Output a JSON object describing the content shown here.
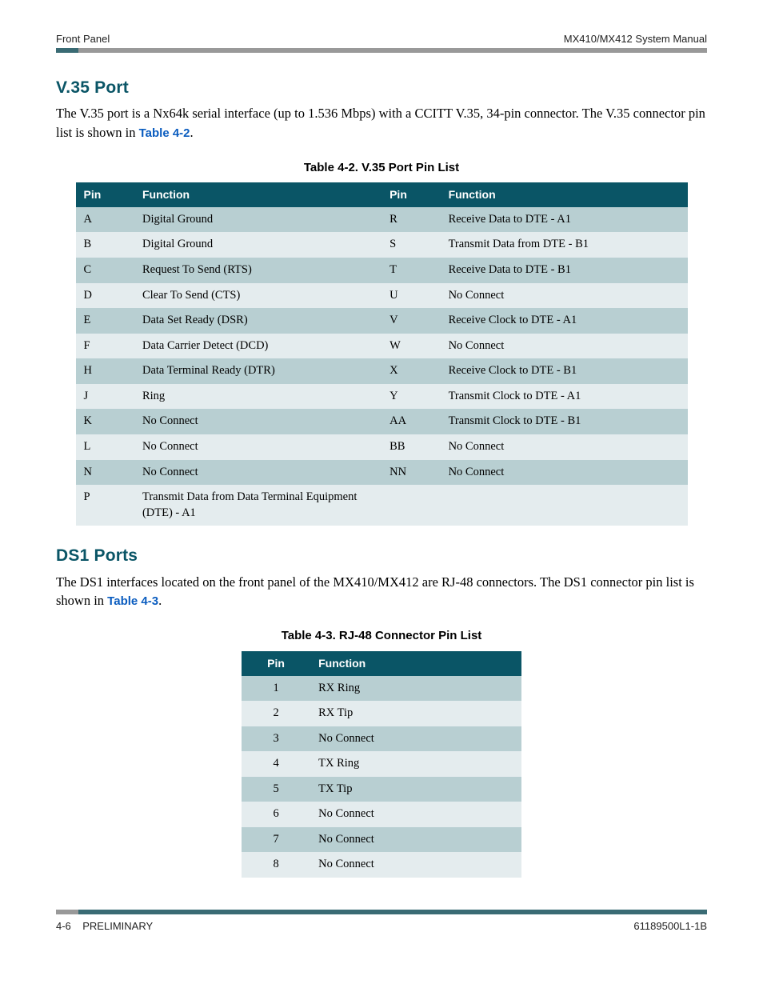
{
  "header": {
    "left": "Front Panel",
    "right": "MX410/MX412 System Manual"
  },
  "section1": {
    "heading": "V.35 Port",
    "para_a": "The V.35 port is a Nx64k serial interface (up to 1.536 Mbps) with a CCITT V.35, 34-pin connector. The V.35 connector pin list is shown in ",
    "xref": "Table 4-2",
    "para_b": "."
  },
  "table1": {
    "caption": "Table 4-2.  V.35 Port Pin List",
    "head": {
      "pin": "Pin",
      "func": "Function"
    },
    "rows": [
      {
        "p1": "A",
        "f1": "Digital Ground",
        "p2": "R",
        "f2": "Receive Data to DTE - A1"
      },
      {
        "p1": "B",
        "f1": "Digital Ground",
        "p2": "S",
        "f2": "Transmit Data from DTE - B1"
      },
      {
        "p1": "C",
        "f1": "Request To Send (RTS)",
        "p2": "T",
        "f2": "Receive Data to DTE - B1"
      },
      {
        "p1": "D",
        "f1": "Clear To Send (CTS)",
        "p2": "U",
        "f2": "No Connect"
      },
      {
        "p1": "E",
        "f1": "Data Set Ready (DSR)",
        "p2": "V",
        "f2": "Receive Clock to DTE - A1"
      },
      {
        "p1": "F",
        "f1": "Data Carrier Detect (DCD)",
        "p2": "W",
        "f2": "No Connect"
      },
      {
        "p1": "H",
        "f1": "Data Terminal Ready (DTR)",
        "p2": "X",
        "f2": "Receive Clock to DTE - B1"
      },
      {
        "p1": "J",
        "f1": "Ring",
        "p2": "Y",
        "f2": "Transmit Clock to DTE - A1"
      },
      {
        "p1": "K",
        "f1": "No Connect",
        "p2": "AA",
        "f2": "Transmit Clock to DTE - B1"
      },
      {
        "p1": "L",
        "f1": "No Connect",
        "p2": "BB",
        "f2": "No Connect"
      },
      {
        "p1": "N",
        "f1": "No Connect",
        "p2": "NN",
        "f2": "No Connect"
      },
      {
        "p1": "P",
        "f1": "Transmit Data from Data Terminal Equipment (DTE) - A1",
        "p2": "",
        "f2": ""
      }
    ]
  },
  "section2": {
    "heading": "DS1 Ports",
    "para_a": "The DS1 interfaces located on the front panel of the MX410/MX412 are RJ-48 connectors. The DS1 connector pin list is shown in ",
    "xref": "Table 4-3",
    "para_b": "."
  },
  "table2": {
    "caption": "Table 4-3.  RJ-48 Connector Pin List",
    "head": {
      "pin": "Pin",
      "func": "Function"
    },
    "rows": [
      {
        "pin": "1",
        "func": "RX Ring"
      },
      {
        "pin": "2",
        "func": "RX Tip"
      },
      {
        "pin": "3",
        "func": "No Connect"
      },
      {
        "pin": "4",
        "func": "TX Ring"
      },
      {
        "pin": "5",
        "func": "TX Tip"
      },
      {
        "pin": "6",
        "func": "No Connect"
      },
      {
        "pin": "7",
        "func": "No Connect"
      },
      {
        "pin": "8",
        "func": "No Connect"
      }
    ]
  },
  "footer": {
    "left_page": "4-6",
    "left_status": "PRELIMINARY",
    "right": "61189500L1-1B"
  }
}
